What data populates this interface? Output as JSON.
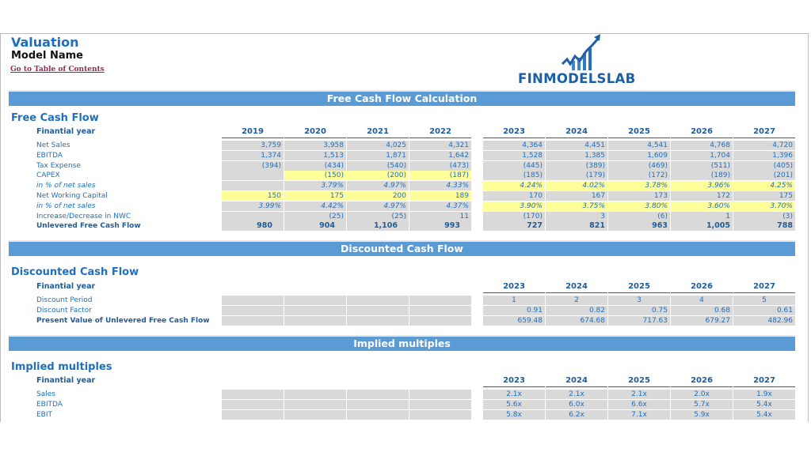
{
  "header": {
    "title": "Valuation",
    "model_name": "Model Name",
    "toc_link": "Go to Table of Contents",
    "logo_text": "FINMODELSLAB"
  },
  "colors": {
    "band": "#5b9bd5",
    "title_blue": "#1f6fbf",
    "cell_gray": "#d9d9d9",
    "cell_yellow": "#ffff99",
    "link": "#9a2a55"
  },
  "fcf": {
    "band_title": "Free Cash Flow Calculation",
    "section_title": "Free Cash Flow",
    "fy_label": "Finantial year",
    "years_hist": [
      "2019",
      "2020",
      "2021",
      "2022"
    ],
    "years_proj": [
      "2023",
      "2024",
      "2025",
      "2026",
      "2027"
    ],
    "rows": [
      {
        "label": "Net Sales",
        "style": "normal",
        "hist": [
          "3,759",
          "3,958",
          "4,025",
          "4,321"
        ],
        "proj": [
          "4,364",
          "4,451",
          "4,541",
          "4,768",
          "4,720"
        ],
        "hist_yellow": [
          false,
          false,
          false,
          false
        ],
        "proj_yellow": [
          false,
          false,
          false,
          false,
          false
        ]
      },
      {
        "label": "EBITDA",
        "style": "normal",
        "hist": [
          "1,374",
          "1,513",
          "1,871",
          "1,642"
        ],
        "proj": [
          "1,528",
          "1,385",
          "1,609",
          "1,704",
          "1,396"
        ],
        "hist_yellow": [
          false,
          false,
          false,
          false
        ],
        "proj_yellow": [
          false,
          false,
          false,
          false,
          false
        ]
      },
      {
        "label": "Tax Expense",
        "style": "normal",
        "hist": [
          "(394)",
          "(434)",
          "(540)",
          "(473)"
        ],
        "proj": [
          "(445)",
          "(389)",
          "(469)",
          "(511)",
          "(405)"
        ],
        "hist_yellow": [
          false,
          false,
          false,
          false
        ],
        "proj_yellow": [
          false,
          false,
          false,
          false,
          false
        ]
      },
      {
        "label": "CAPEX",
        "style": "normal",
        "hist": [
          "",
          "(150)",
          "(200)",
          "(187)"
        ],
        "proj": [
          "(185)",
          "(179)",
          "(172)",
          "(189)",
          "(201)"
        ],
        "hist_yellow": [
          false,
          true,
          true,
          true
        ],
        "proj_yellow": [
          false,
          false,
          false,
          false,
          false
        ]
      },
      {
        "label": "in % of net sales",
        "style": "italic",
        "hist": [
          "",
          "3.79%",
          "4.97%",
          "4.33%"
        ],
        "proj": [
          "4.24%",
          "4.02%",
          "3.78%",
          "3.96%",
          "4.25%"
        ],
        "hist_yellow": [
          false,
          false,
          false,
          false
        ],
        "proj_yellow": [
          true,
          true,
          true,
          true,
          true
        ]
      },
      {
        "label": "Net Working Capital",
        "style": "normal",
        "hist": [
          "150",
          "175",
          "200",
          "189"
        ],
        "proj": [
          "170",
          "167",
          "173",
          "172",
          "175"
        ],
        "hist_yellow": [
          true,
          true,
          true,
          true
        ],
        "proj_yellow": [
          false,
          false,
          false,
          false,
          false
        ]
      },
      {
        "label": "in % of net sales",
        "style": "italic",
        "hist": [
          "3.99%",
          "4.42%",
          "4.97%",
          "4.37%"
        ],
        "proj": [
          "3.90%",
          "3.75%",
          "3.80%",
          "3.60%",
          "3.70%"
        ],
        "hist_yellow": [
          false,
          false,
          false,
          false
        ],
        "proj_yellow": [
          true,
          true,
          true,
          true,
          true
        ]
      },
      {
        "label": "Increase/Decrease in NWC",
        "style": "normal",
        "hist": [
          "",
          "(25)",
          "(25)",
          "11"
        ],
        "proj": [
          "(170)",
          "3",
          "(6)",
          "1",
          "(3)"
        ],
        "hist_yellow": [
          false,
          false,
          false,
          false
        ],
        "proj_yellow": [
          false,
          false,
          false,
          false,
          false
        ]
      },
      {
        "label": "Unlevered Free Cash Flow",
        "style": "bold",
        "hist": [
          "980",
          "904",
          "1,106",
          "993"
        ],
        "proj": [
          "727",
          "821",
          "963",
          "1,005",
          "788"
        ],
        "hist_yellow": [
          false,
          false,
          false,
          false
        ],
        "proj_yellow": [
          false,
          false,
          false,
          false,
          false
        ]
      }
    ]
  },
  "dcf": {
    "band_title": "Discounted Cash Flow",
    "section_title": "Discounted Cash Flow",
    "fy_label": "Finantial year",
    "years_proj": [
      "2023",
      "2024",
      "2025",
      "2026",
      "2027"
    ],
    "rows": [
      {
        "label": "Discount Period",
        "style": "normal",
        "align": "center",
        "proj": [
          "1",
          "2",
          "3",
          "4",
          "5"
        ]
      },
      {
        "label": "Discount Factor",
        "style": "normal",
        "align": "right",
        "proj": [
          "0.91",
          "0.82",
          "0.75",
          "0.68",
          "0.61"
        ]
      },
      {
        "label": "Present Value of Unlevered Free Cash Flow",
        "style": "boldlabel",
        "align": "right",
        "proj": [
          "659.48",
          "674.68",
          "717.63",
          "679.27",
          "482.96"
        ]
      }
    ]
  },
  "multiples": {
    "band_title": "Implied multiples",
    "section_title": "Implied multiples",
    "fy_label": "Finantial year",
    "years_proj": [
      "2023",
      "2024",
      "2025",
      "2026",
      "2027"
    ],
    "rows": [
      {
        "label": "Sales",
        "style": "normal",
        "align": "center",
        "proj": [
          "2.1x",
          "2.1x",
          "2.1x",
          "2.0x",
          "1.9x"
        ]
      },
      {
        "label": "EBITDA",
        "style": "normal",
        "align": "center",
        "proj": [
          "5.6x",
          "6.0x",
          "6.6x",
          "5.7x",
          "5.4x"
        ]
      },
      {
        "label": "EBIT",
        "style": "normal",
        "align": "center",
        "proj": [
          "5.8x",
          "6.2x",
          "7.1x",
          "5.9x",
          "5.4x"
        ]
      }
    ]
  }
}
